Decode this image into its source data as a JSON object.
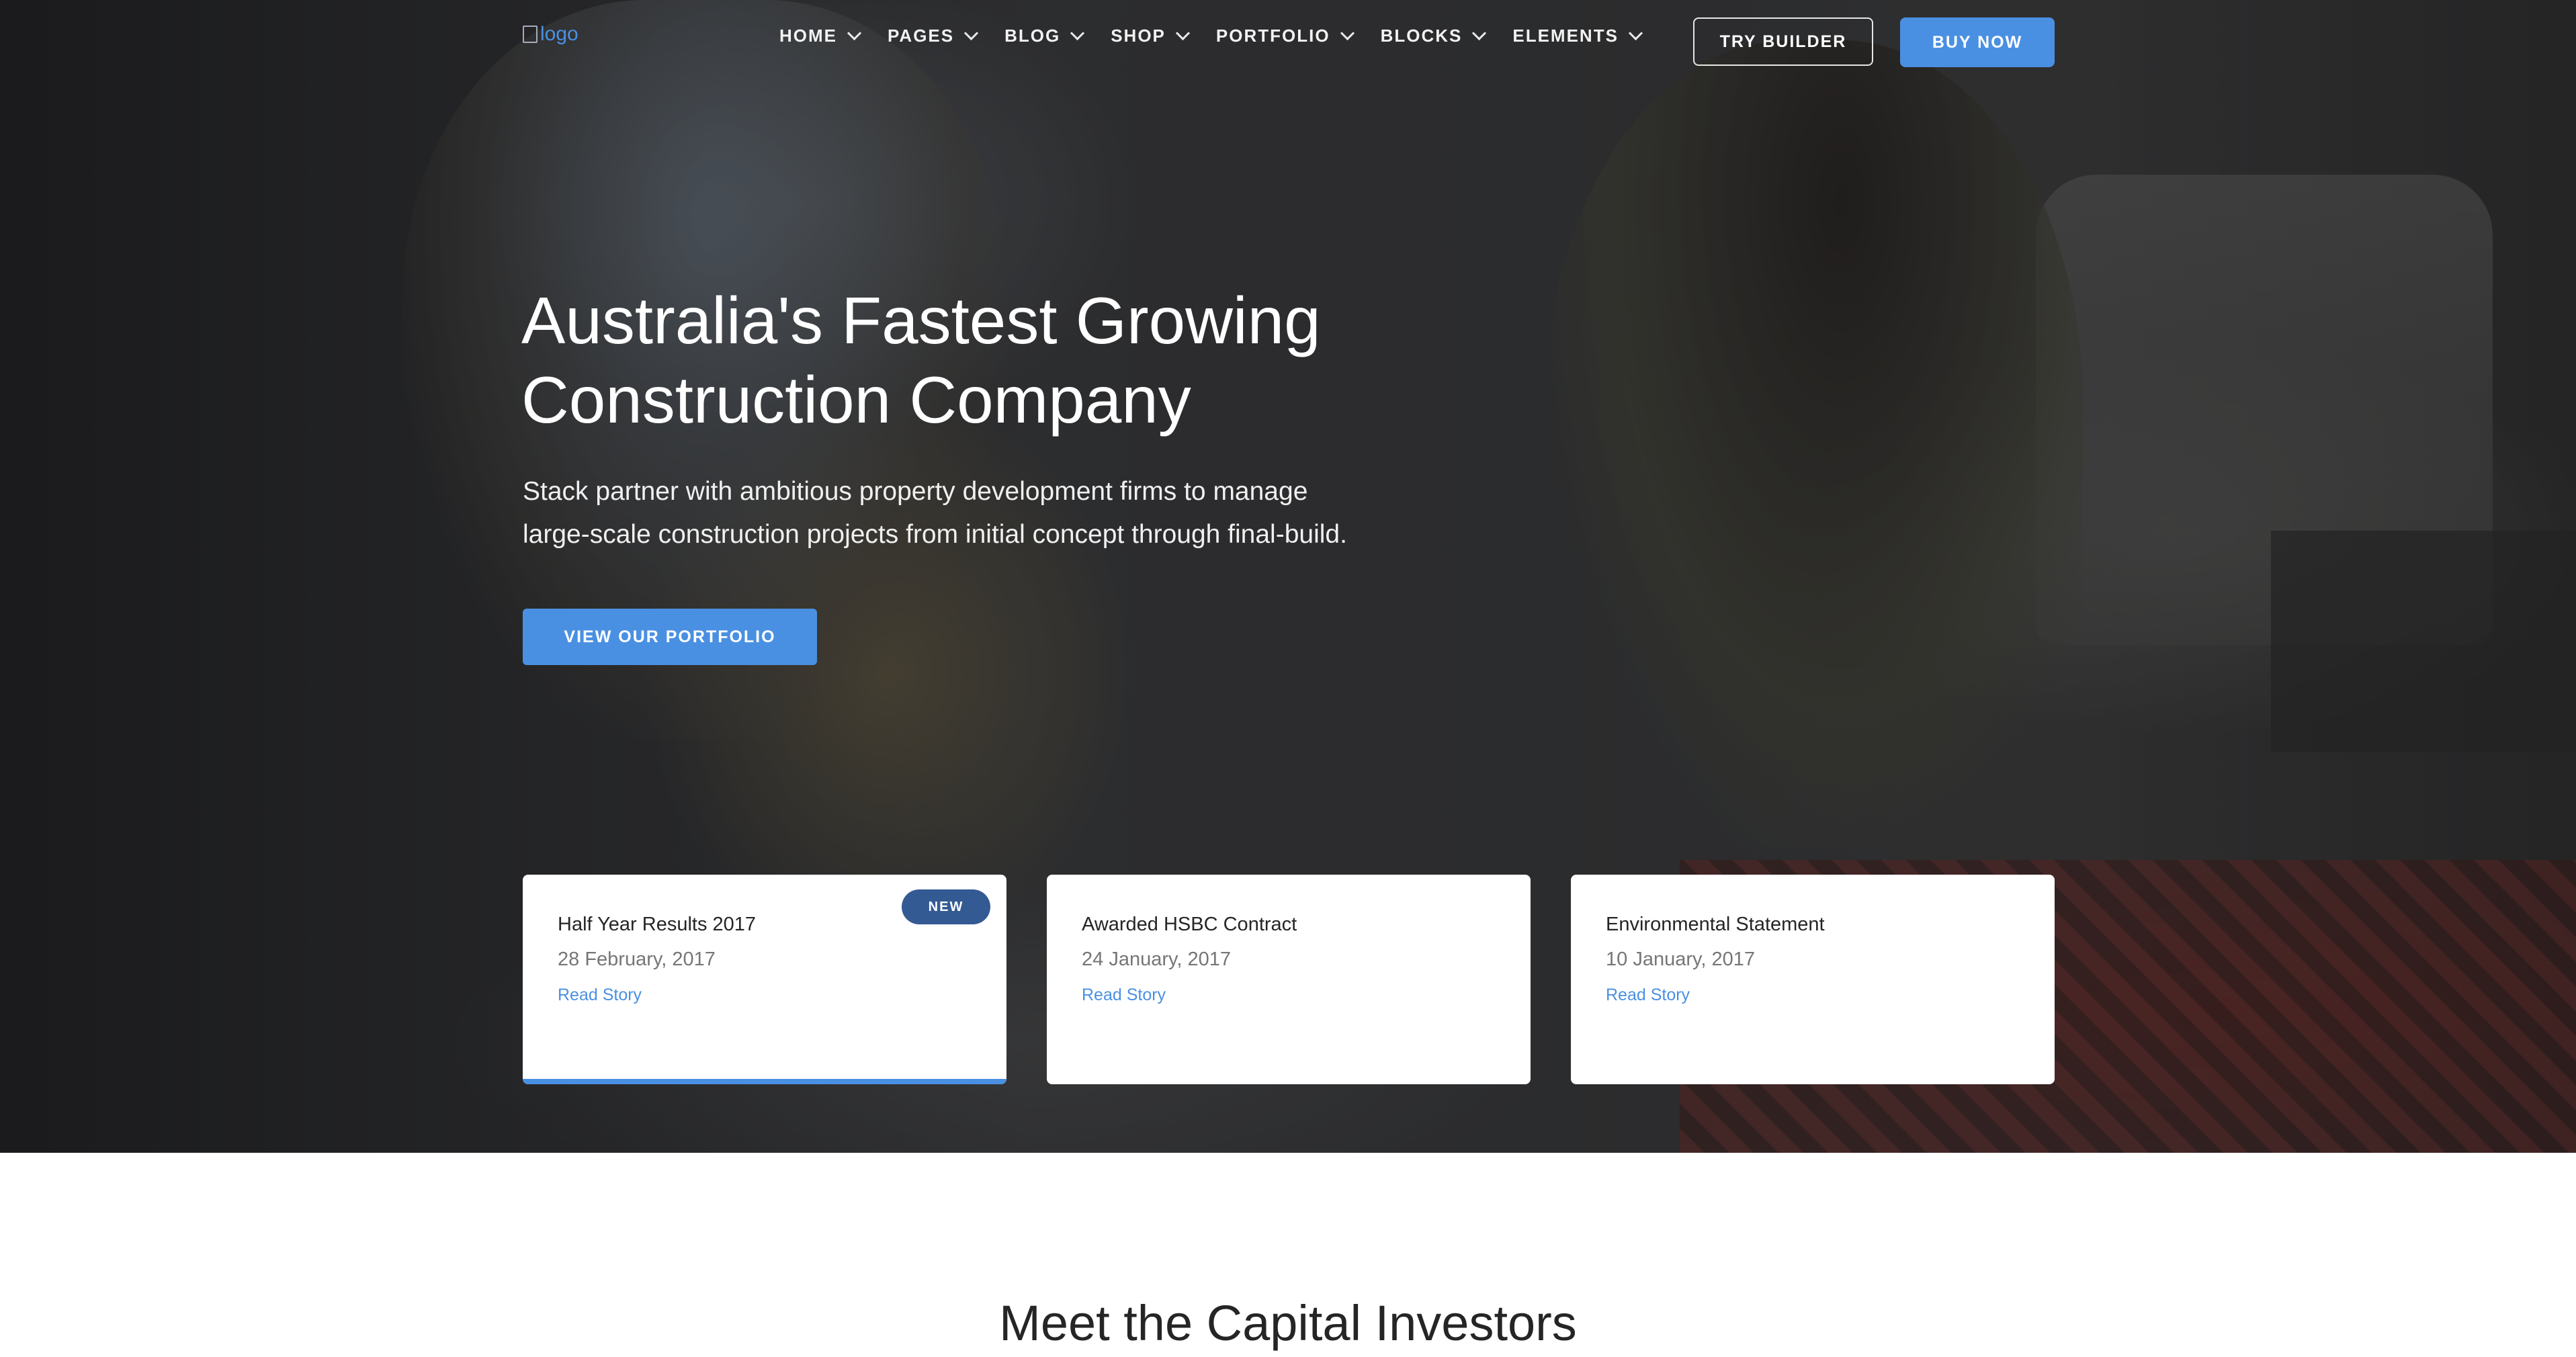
{
  "nav": {
    "logo_alt": "logo",
    "items": [
      {
        "label": "HOME"
      },
      {
        "label": "PAGES"
      },
      {
        "label": "BLOG"
      },
      {
        "label": "SHOP"
      },
      {
        "label": "PORTFOLIO"
      },
      {
        "label": "BLOCKS"
      },
      {
        "label": "ELEMENTS"
      }
    ],
    "try_builder": "TRY BUILDER",
    "buy_now": "BUY NOW"
  },
  "hero": {
    "title_line1": "Australia's Fastest Growing",
    "title_line2": "Construction Company",
    "lead_line1": "Stack partner with ambitious property development firms to manage",
    "lead_line2": "large-scale construction projects from initial concept through final-build.",
    "cta": "VIEW OUR PORTFOLIO"
  },
  "cards": [
    {
      "title": "Half Year Results 2017",
      "date": "28 February, 2017",
      "link": "Read Story",
      "badge": "NEW"
    },
    {
      "title": "Awarded HSBC Contract",
      "date": "24 January, 2017",
      "link": "Read Story"
    },
    {
      "title": "Environmental Statement",
      "date": "10 January, 2017",
      "link": "Read Story"
    }
  ],
  "section": {
    "title": "Meet the Capital Investors"
  },
  "colors": {
    "accent": "#4a90e2",
    "badge": "#345a94"
  }
}
